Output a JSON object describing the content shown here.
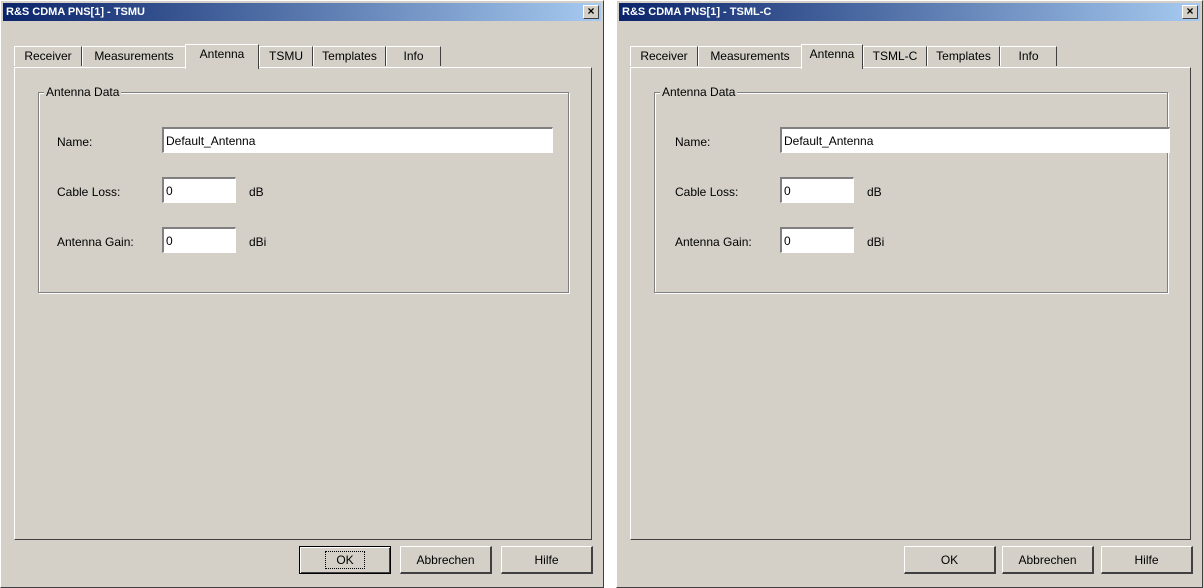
{
  "dialogs": [
    {
      "title": "R&S CDMA PNS[1] - TSMU",
      "close_glyph": "×",
      "tabs": [
        "Receiver",
        "Measurements",
        "Antenna",
        "TSMU",
        "Templates",
        "Info"
      ],
      "active_tab": "Antenna",
      "group_title": "Antenna Data",
      "name_label": "Name:",
      "name_value": "Default_Antenna",
      "cable_loss_label": "Cable Loss:",
      "cable_loss_value": "0",
      "cable_loss_unit": "dB",
      "antenna_gain_label": "Antenna Gain:",
      "antenna_gain_value": "0",
      "antenna_gain_unit": "dBi",
      "buttons": {
        "ok": "OK",
        "cancel": "Abbrechen",
        "help": "Hilfe"
      }
    },
    {
      "title": "R&S CDMA PNS[1] - TSML-C",
      "close_glyph": "×",
      "tabs": [
        "Receiver",
        "Measurements",
        "Antenna",
        "TSML-C",
        "Templates",
        "Info"
      ],
      "active_tab": "Antenna",
      "group_title": "Antenna Data",
      "name_label": "Name:",
      "name_value": "Default_Antenna",
      "cable_loss_label": "Cable Loss:",
      "cable_loss_value": "0",
      "cable_loss_unit": "dB",
      "antenna_gain_label": "Antenna Gain:",
      "antenna_gain_value": "0",
      "antenna_gain_unit": "dBi",
      "buttons": {
        "ok": "OK",
        "cancel": "Abbrechen",
        "help": "Hilfe"
      }
    }
  ],
  "colors": {
    "dialog_face": "#d4d0c8",
    "titlebar_start": "#0a246a",
    "titlebar_end": "#a6caf0"
  }
}
